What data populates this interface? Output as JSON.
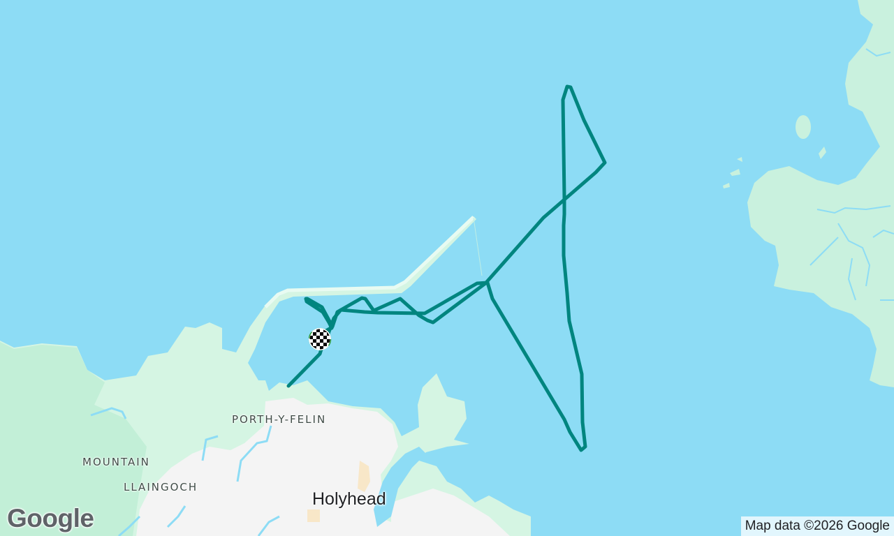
{
  "map": {
    "place_labels": {
      "porth_y_felin": "PORTH-Y-FELIN",
      "mountain": "MOUNTAIN",
      "llaingoch": "LLAINGOCH"
    },
    "town_label": "Holyhead",
    "google_logo": "Google",
    "attribution": "Map data ©2026 Google",
    "colors": {
      "water": "#8ddcf5",
      "land": "#d5f5e3",
      "urban": "#f4f4f4",
      "track": "#00857f"
    },
    "markers": {
      "finish": "checkered-flag-icon"
    }
  }
}
